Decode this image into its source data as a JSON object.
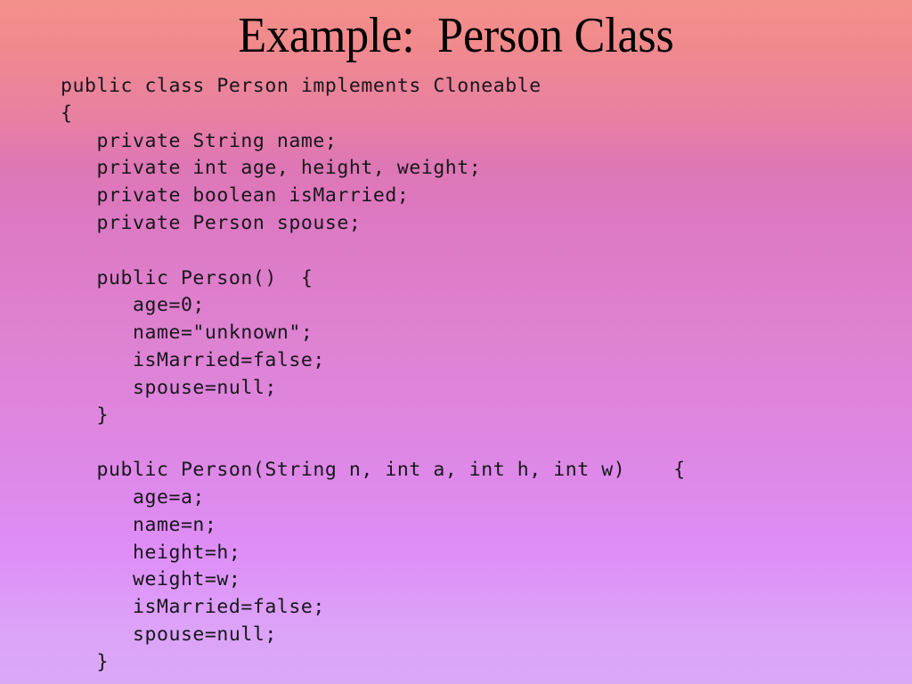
{
  "slide": {
    "title": "Example:  Person Class",
    "background": {
      "type": "vertical-gradient",
      "top_color": "#f4908c",
      "upper_mid_color": "#de77b4",
      "mid_color": "#de82d2",
      "lower_mid_color": "#de8ef7",
      "bottom_color": "#d9a9f5"
    },
    "text_color": "#17161c"
  },
  "code": {
    "language": "java",
    "lines": [
      "public class Person implements Cloneable",
      "{",
      "   private String name;",
      "   private int age, height, weight;",
      "   private boolean isMarried;",
      "   private Person spouse;",
      "",
      "   public Person()  {",
      "      age=0;",
      "      name=\"unknown\";",
      "      isMarried=false;",
      "      spouse=null;",
      "   }",
      "",
      "   public Person(String n, int a, int h, int w)    {",
      "      age=a;",
      "      name=n;",
      "      height=h;",
      "      weight=w;",
      "      isMarried=false;",
      "      spouse=null;",
      "   }"
    ]
  }
}
